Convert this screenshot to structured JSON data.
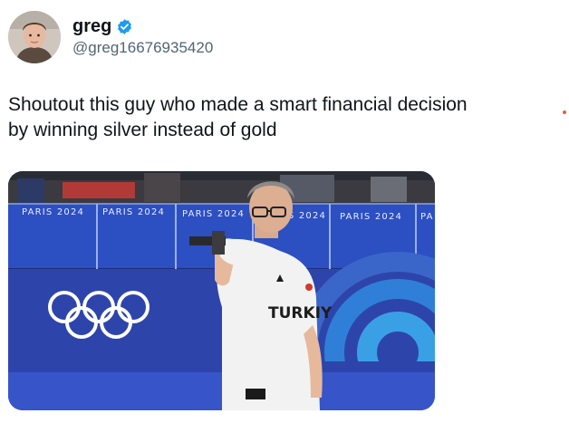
{
  "author": {
    "display_name": "greg",
    "handle": "@greg16676935420",
    "verified": true,
    "verified_icon": "verified-badge-icon",
    "badge_color": "#1d9bf0"
  },
  "tweet": {
    "text": "Shoutout this guy who made a smart financial decision by winning silver instead of gold"
  },
  "media": {
    "board_labels": [
      "PARIS 2024",
      "PARIS 2024",
      "PARIS 2024",
      "PARIS 2024",
      "PARIS 2024",
      "PA"
    ],
    "shirt_text": "TURKIY"
  },
  "colors": {
    "text_primary": "#0f1419",
    "text_secondary": "#536471",
    "accent_dot": "#f05a3c"
  }
}
